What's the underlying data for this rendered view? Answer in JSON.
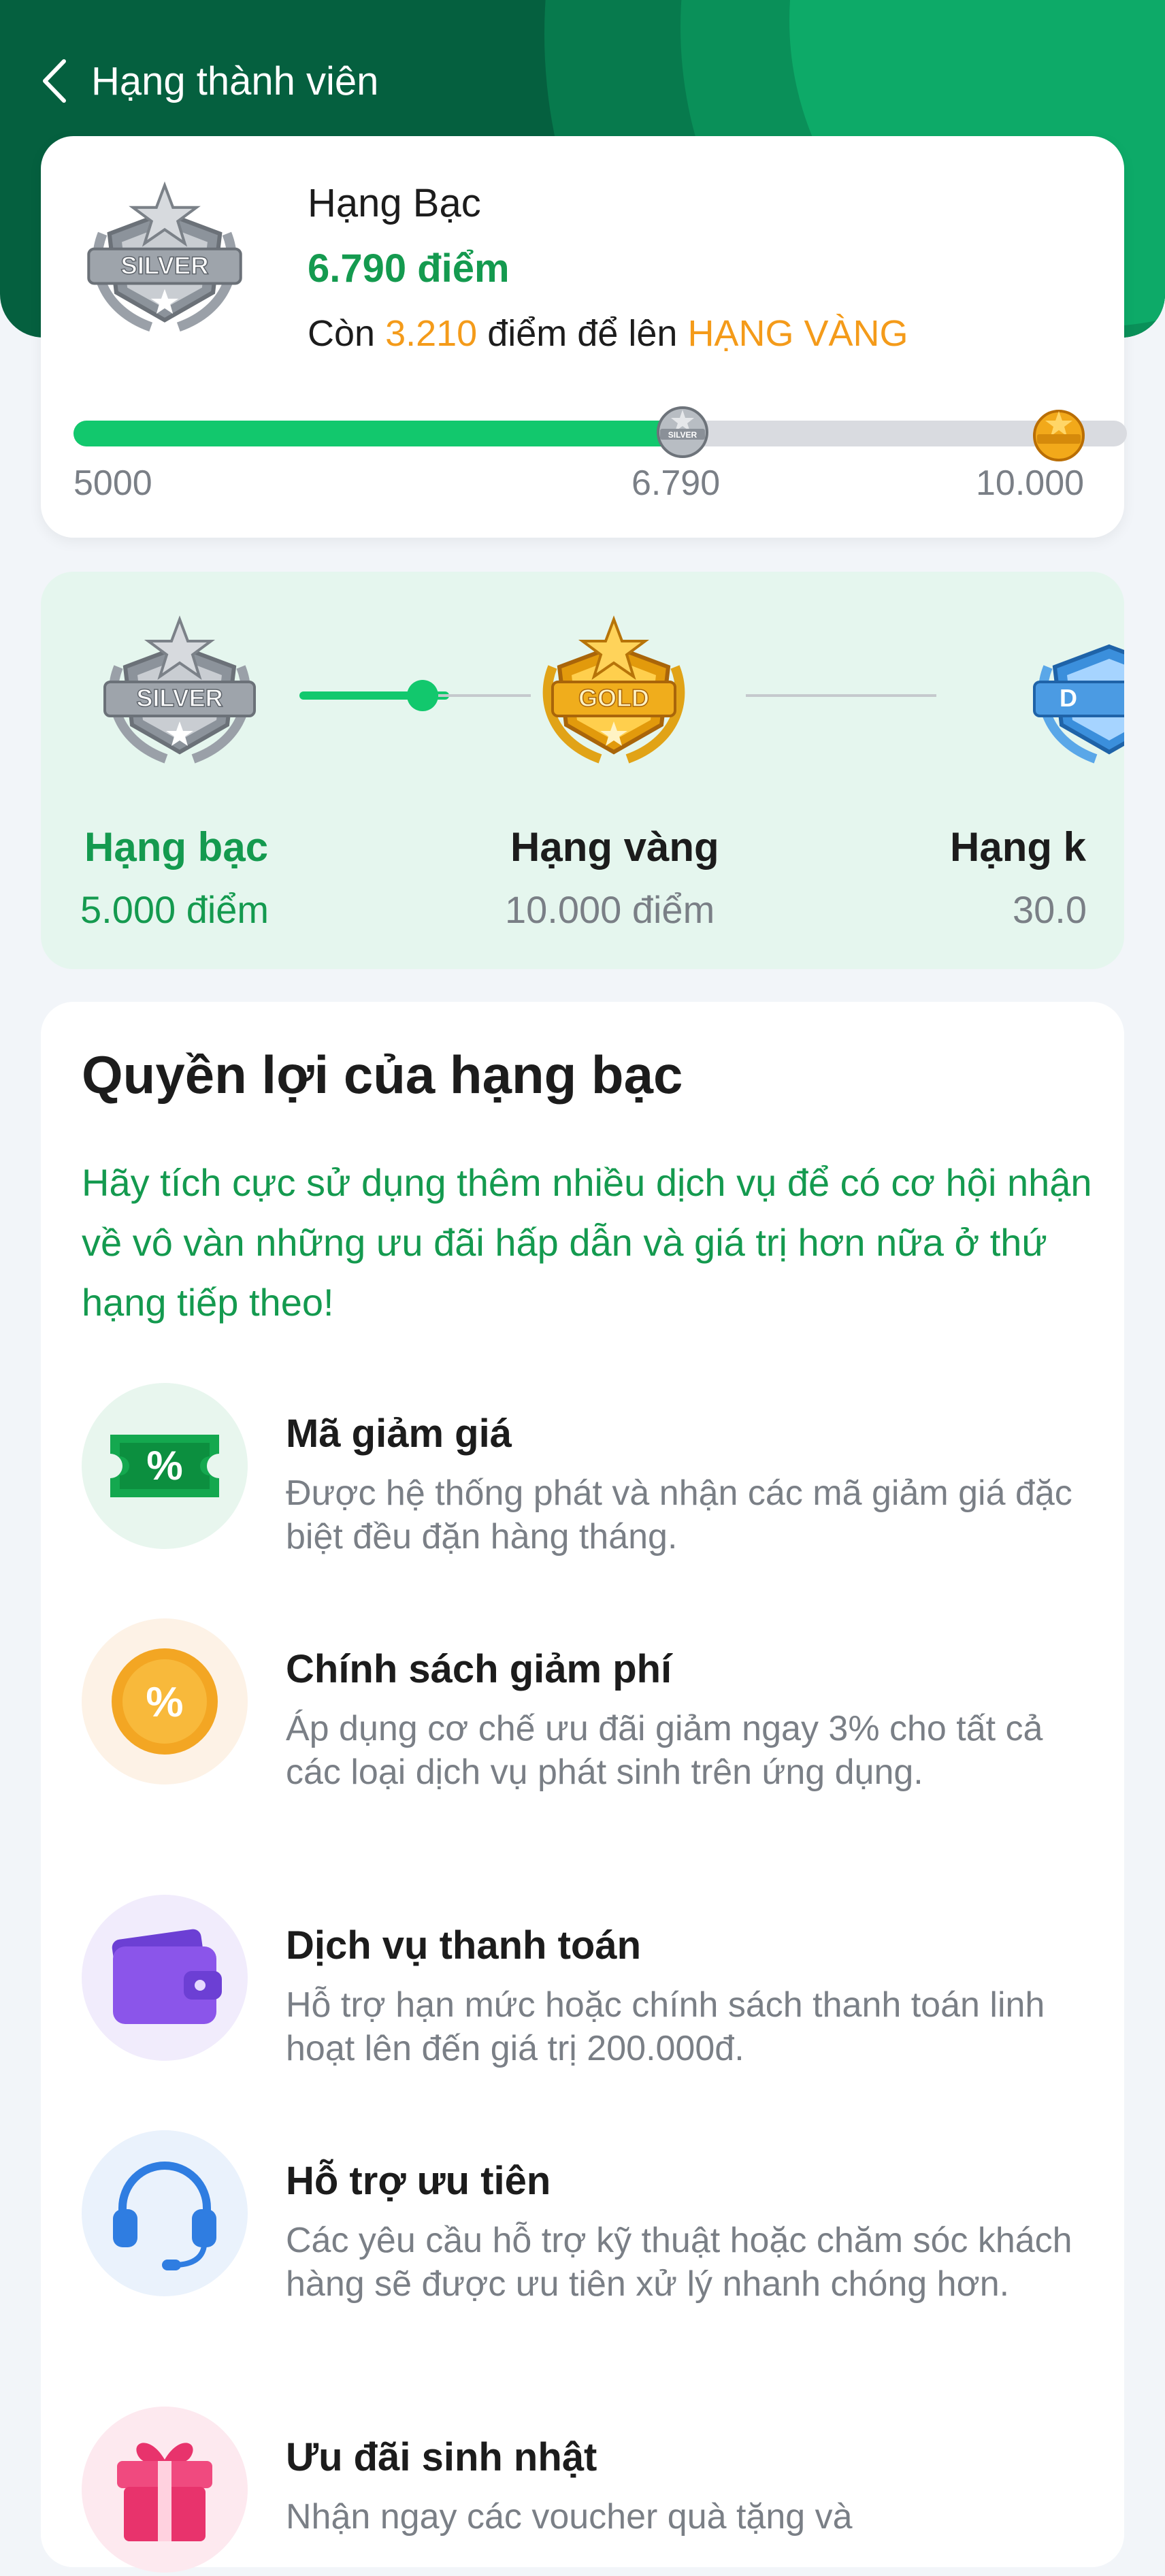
{
  "header": {
    "title": "Hạng thành viên"
  },
  "summary": {
    "rank_name": "Hạng Bạc",
    "points": "6.790 điểm",
    "remain_prefix": "Còn",
    "remain_points": "3.210",
    "remain_middle": "điểm để lên",
    "next_rank": "HẠNG VÀNG",
    "progress_fraction": 0.597,
    "badge_text": "SILVER",
    "bar_labels": {
      "start": "5000",
      "current": "6.790",
      "end": "10.000"
    },
    "bar_silver_text": "SILVER"
  },
  "tiers": [
    {
      "name": "Hạng bạc",
      "points": "5.000 điểm",
      "badge": "SILVER"
    },
    {
      "name": "Hạng vàng",
      "points": "10.000 điểm",
      "badge": "GOLD"
    },
    {
      "name": "Hạng k",
      "points": "30.0",
      "badge": "D"
    }
  ],
  "benefits_section": {
    "heading": "Quyền lợi của hạng bạc",
    "intro": "Hãy tích cực sử dụng thêm nhiều dịch vụ để có cơ hội nhận về vô vàn những ưu đãi hấp dẫn và giá trị hơn nữa ở thứ hạng tiếp theo!",
    "items": [
      {
        "title": "Mã giảm giá",
        "desc": "Được hệ thống phát và nhận các mã giảm giá đặc biệt đều đặn hàng tháng.",
        "icon": "coupon-icon"
      },
      {
        "title": "Chính sách giảm phí",
        "desc": "Áp dụng cơ chế ưu đãi giảm ngay 3% cho tất cả các loại dịch vụ phát sinh trên ứng dụng.",
        "icon": "percent-coin-icon"
      },
      {
        "title": "Dịch vụ thanh toán",
        "desc": "Hỗ trợ hạn mức hoặc chính sách thanh toán linh hoạt lên đến giá trị 200.000đ.",
        "icon": "wallet-icon"
      },
      {
        "title": "Hỗ trợ ưu tiên",
        "desc": "Các yêu cầu hỗ trợ kỹ thuật hoặc chăm sóc khách hàng sẽ được ưu tiên xử lý nhanh chóng hơn.",
        "icon": "headset-icon"
      },
      {
        "title": "Ưu đãi sinh nhật",
        "desc": "Nhận ngay các voucher quà tặng và",
        "icon": "gift-icon"
      }
    ]
  },
  "colors": {
    "primary_green": "#149a4f",
    "bar_green": "#12c86d",
    "accent_orange": "#f49b1a",
    "header_green": "#05603f"
  }
}
